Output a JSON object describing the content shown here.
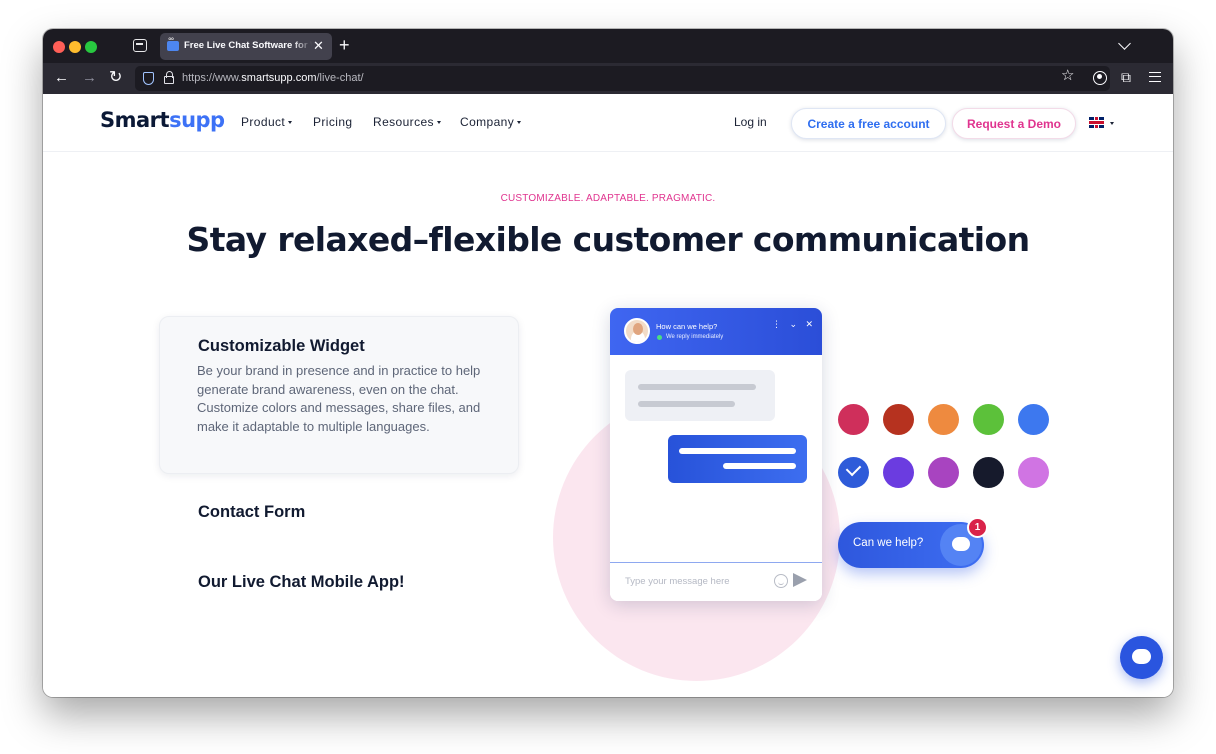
{
  "browser": {
    "tab_title": "Free Live Chat Software for Website",
    "url_prefix": "https://www.",
    "url_host": "smartsupp.com",
    "url_path": "/live-chat/"
  },
  "header": {
    "logo_part1": "Smart",
    "logo_part2": "supp",
    "nav": [
      "Product",
      "Pricing",
      "Resources",
      "Company"
    ],
    "login": "Log in",
    "create_account": "Create a free account",
    "request_demo": "Request a Demo"
  },
  "hero": {
    "eyebrow": "CUSTOMIZABLE. ADAPTABLE. PRAGMATIC.",
    "headline": "Stay relaxed–flexible customer communication"
  },
  "features": [
    {
      "title": "Customizable Widget",
      "description": "Be your brand in presence and in practice to help generate brand awareness, even on the chat. Customize colors and messages, share files, and make it adaptable to multiple languages."
    },
    {
      "title": "Contact Form"
    },
    {
      "title": "Our Live Chat Mobile App!"
    }
  ],
  "widget": {
    "question": "How can we help?",
    "status": "We reply immediately",
    "controls": "⋮ ⌄ ✕",
    "input_placeholder": "Type your message here",
    "help_button": "Can we help?",
    "badge_count": "1"
  },
  "swatches": {
    "colors": [
      "#cf2f5b",
      "#b6321f",
      "#ee8a3f",
      "#5cc13a",
      "#3d78ef",
      "#2e5bd9",
      "#6b3ce0",
      "#a844c0",
      "#161a2c",
      "#d074e3"
    ],
    "selected_index": 5
  }
}
